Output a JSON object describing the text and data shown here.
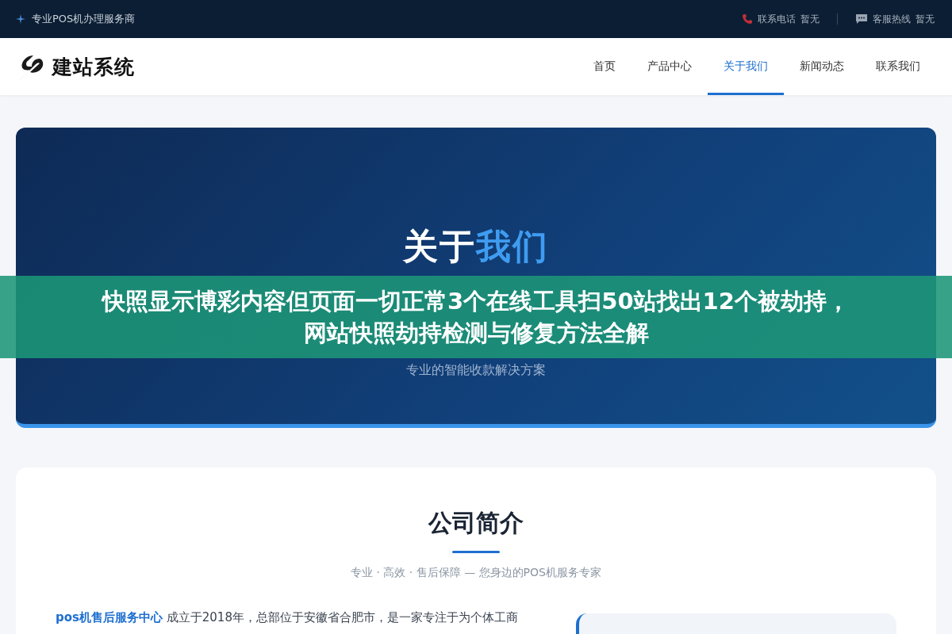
{
  "top_bar": {
    "tagline": "专业POS机办理服务商",
    "contacts": [
      {
        "kind": "phone",
        "label": "联系电话",
        "value": "暂无"
      },
      {
        "kind": "chat",
        "label": "客服热线",
        "value": "暂无"
      }
    ]
  },
  "header": {
    "logo_text": "建站系统",
    "nav": [
      {
        "label": "首页",
        "selected": false
      },
      {
        "label": "产品中心",
        "selected": false
      },
      {
        "label": "关于我们",
        "selected": true
      },
      {
        "label": "新闻动态",
        "selected": false
      },
      {
        "label": "联系我们",
        "selected": false
      }
    ]
  },
  "hero": {
    "title": [
      {
        "text": "关于",
        "accent": false
      },
      {
        "text": "我们",
        "accent": true
      }
    ],
    "subtitle": "专业的智能收款解决方案"
  },
  "overlay_banner": {
    "lines": [
      "快照显示博彩内容但页面一切正常3个在线工具扫50站找出12个被劫持，",
      "网站快照劫持检测与修复方法全解"
    ]
  },
  "company": {
    "title": "公司简介",
    "subtitle": "专业 · 高效 · 售后保障 — 您身边的POS机服务专家",
    "intro": "**pos机售后服务中心** 成立于2018年，总部位于安徽省合肥市，是一家专注于为个体工商"
  }
}
